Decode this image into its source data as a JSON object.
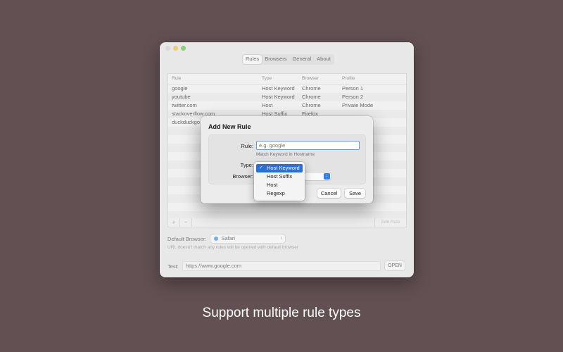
{
  "tabs": [
    "Rules",
    "Browsers",
    "General",
    "About"
  ],
  "table": {
    "headers": [
      "Rule",
      "Type",
      "Browser",
      "Profile"
    ],
    "rows": [
      [
        "google",
        "Host Keyword",
        "Chrome",
        "Person 1"
      ],
      [
        "youtube",
        "Host Keyword",
        "Chrome",
        "Person 2"
      ],
      [
        "twitter.com",
        "Host",
        "Chrome",
        "Private Mode"
      ],
      [
        "stackoverflow.com",
        "Host Suffix",
        "Firefox",
        ""
      ],
      [
        "duckduckgo",
        "",
        "",
        ""
      ]
    ],
    "add_label": "+",
    "remove_label": "−",
    "edit_label": "Edit Rule"
  },
  "default_browser": {
    "label": "Default Browser:",
    "value": "Safari",
    "hint": "URL doesn't match any rules will be opened with default browser"
  },
  "test": {
    "label": "Test:",
    "value": "https://www.google.com",
    "open_label": "OPEN"
  },
  "dialog": {
    "title": "Add New Rule",
    "rule_label": "Rule:",
    "rule_placeholder": "e.g. google",
    "rule_hint": "Match Keyword in Hostname",
    "type_label": "Type:",
    "browser_label": "Browser:",
    "cancel_label": "Cancel",
    "save_label": "Save",
    "type_options": [
      "Host Keyword",
      "Host Suffix",
      "Host",
      "Regexp"
    ],
    "selected_type": "Host Keyword",
    "check_mark": "✓"
  },
  "caption": "Support multiple rule types"
}
